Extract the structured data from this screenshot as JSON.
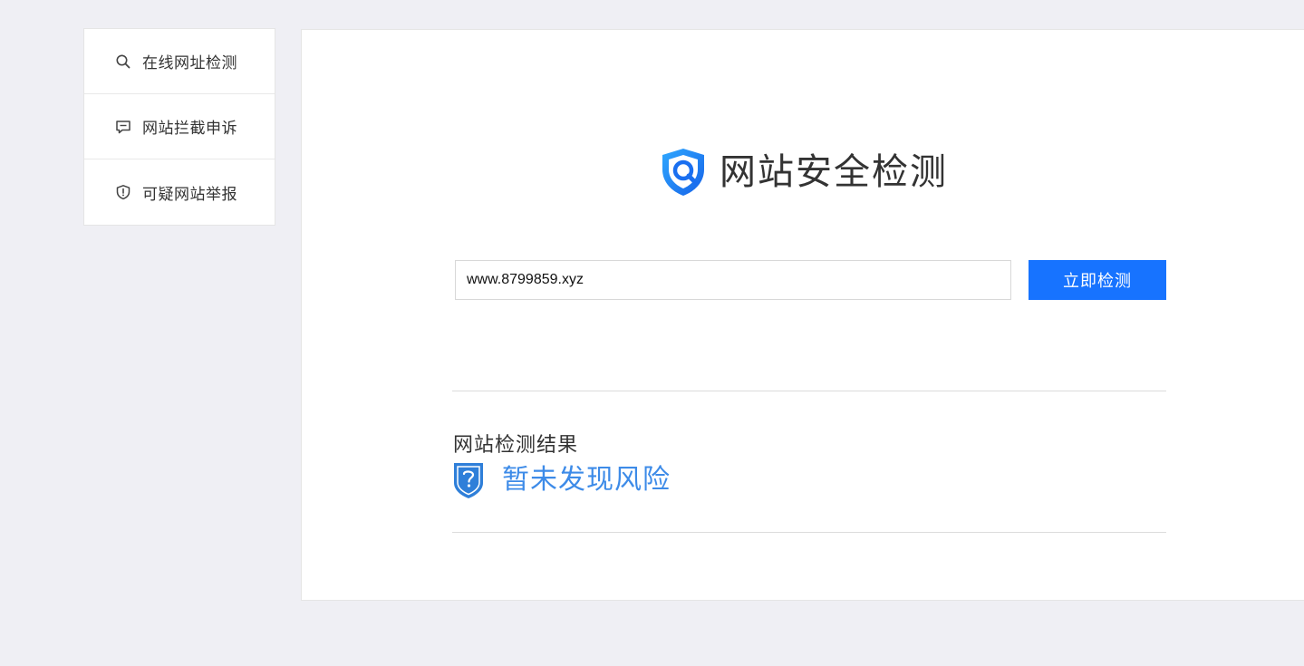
{
  "sidebar": {
    "items": [
      {
        "label": "在线网址检测",
        "icon": "search-icon"
      },
      {
        "label": "网站拦截申诉",
        "icon": "chat-icon"
      },
      {
        "label": "可疑网站举报",
        "icon": "shield-alert-icon"
      }
    ]
  },
  "main": {
    "title": "网站安全检测",
    "search": {
      "value": "www.8799859.xyz",
      "button_label": "立即检测"
    },
    "result": {
      "heading": "网站检测结果",
      "status": "暂未发现风险"
    }
  },
  "colors": {
    "accent": "#1773ff",
    "result_text": "#3d8be8",
    "background": "#efeff4"
  }
}
